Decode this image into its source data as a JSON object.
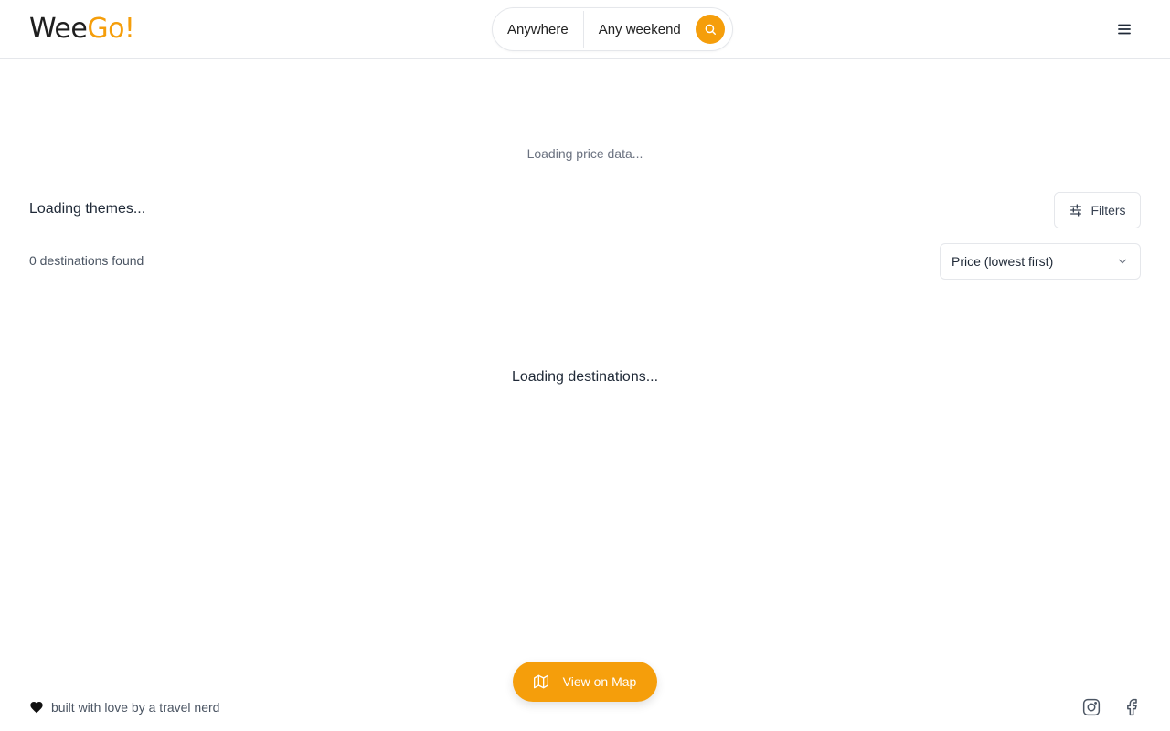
{
  "header": {
    "logo_part1": "Wee",
    "logo_part2": "Go!",
    "search": {
      "location": "Anywhere",
      "dates": "Any weekend"
    }
  },
  "main": {
    "price_status": "Loading price data...",
    "themes_status": "Loading themes...",
    "filters_label": "Filters",
    "destinations_count": "0 destinations found",
    "sort_selected": "Price (lowest first)",
    "destinations_status": "Loading destinations..."
  },
  "map_button": {
    "label": "View on Map"
  },
  "footer": {
    "tagline": "built with love by a travel nerd"
  },
  "icons": {
    "search": "search-icon",
    "menu": "menu-icon",
    "filters": "sliders-icon",
    "chevron": "chevron-down-icon",
    "map": "map-icon",
    "heart": "heart-icon",
    "instagram": "instagram-icon",
    "facebook": "facebook-icon"
  },
  "colors": {
    "accent": "#f59e0b",
    "border": "#e5e7eb",
    "text_muted": "#6b7280"
  }
}
